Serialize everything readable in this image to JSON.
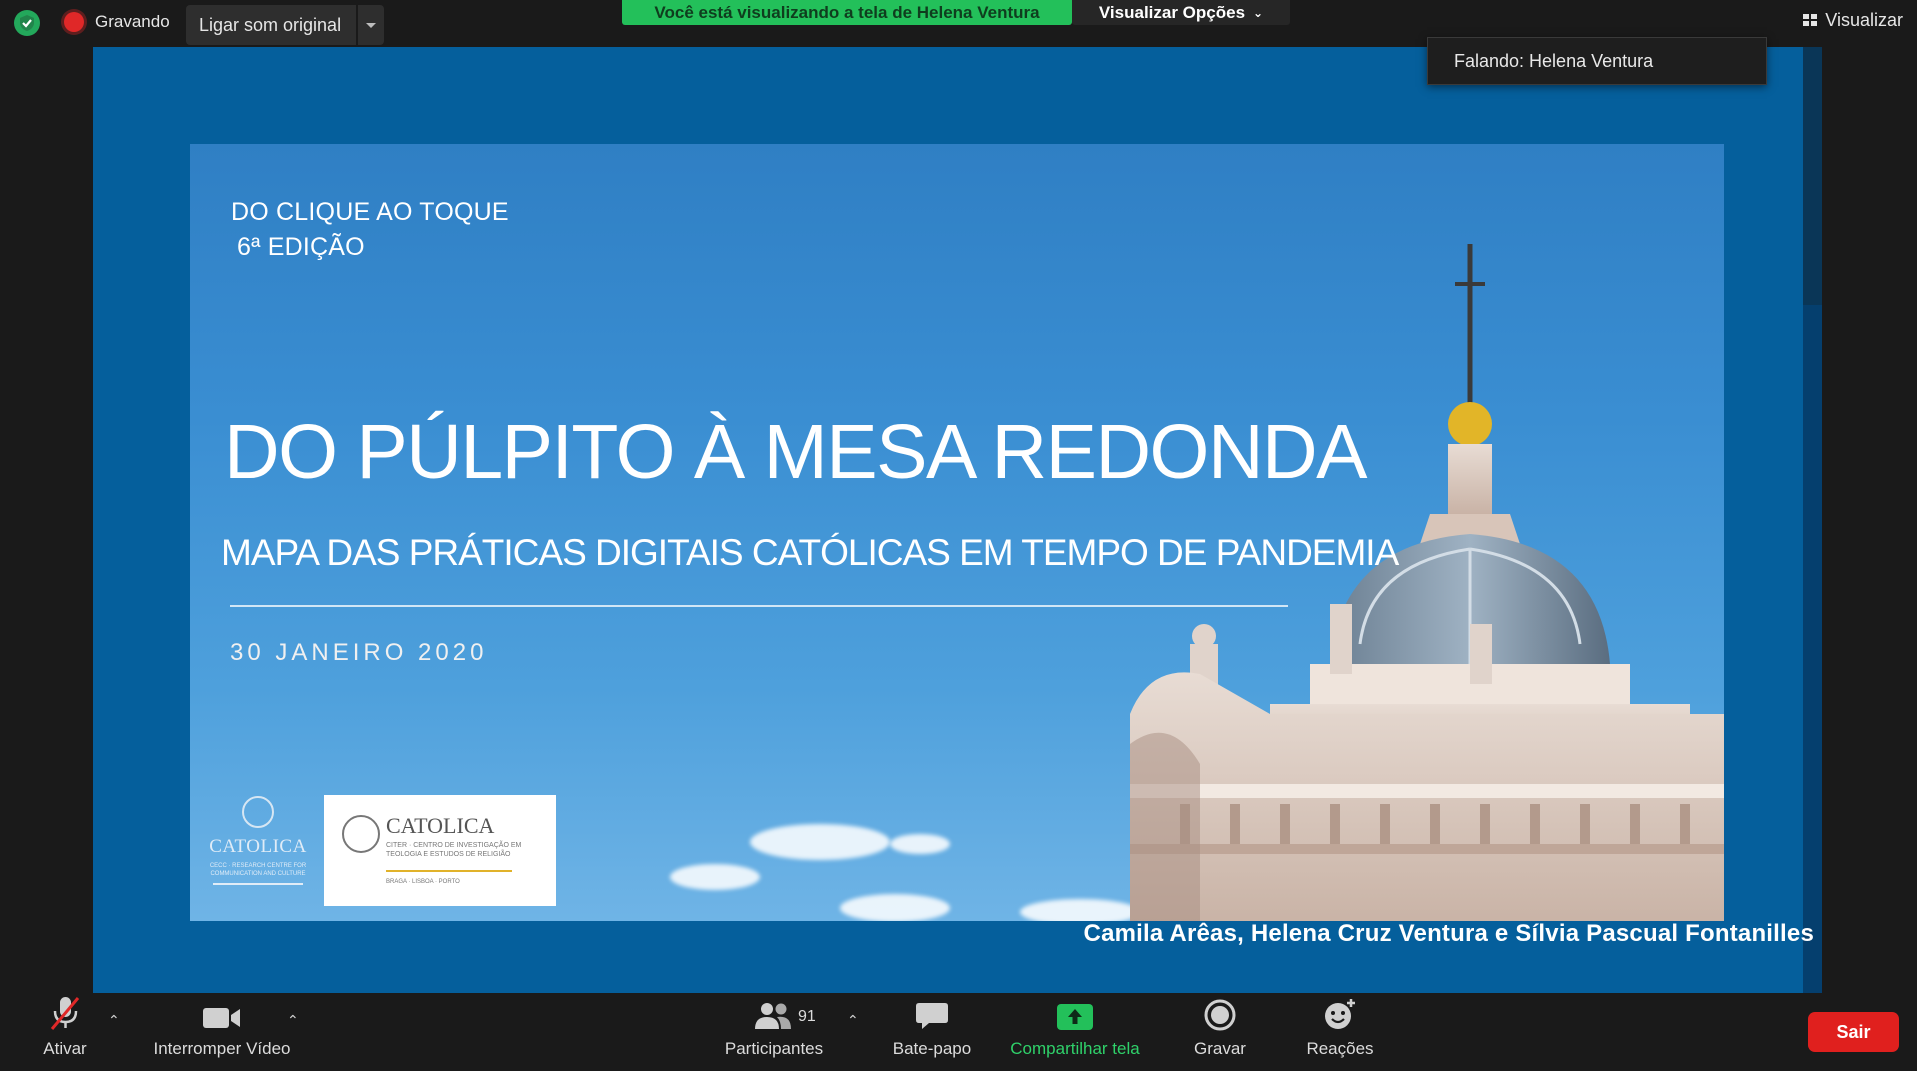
{
  "topbar": {
    "recording_label": "Gravando",
    "original_sound_label": "Ligar som original",
    "share_banner": "Você está visualizando a tela de Helena Ventura",
    "view_options_label": "Visualizar Opções",
    "view_label": "Visualizar"
  },
  "speaker_indicator": "Falando: Helena Ventura",
  "slide": {
    "kicker_line1": "DO CLIQUE AO TOQUE",
    "kicker_line2": "6ª EDIÇÃO",
    "title": "DO PÚLPITO À MESA REDONDA",
    "subtitle": "MAPA DAS PRÁTICAS DIGITAIS CATÓLICAS EM TEMPO DE PANDEMIA",
    "date": "30 JANEIRO 2020",
    "logo1": {
      "name": "CATOLICA",
      "tagline": "CECC · RESEARCH CENTRE FOR COMMUNICATION AND CULTURE"
    },
    "logo2": {
      "name": "CATOLICA",
      "tagline": "CITER · CENTRO DE INVESTIGAÇÃO EM TEOLOGIA E ESTUDOS DE RELIGIÃO",
      "cities": "BRAGA · LISBOA · PORTO"
    },
    "credits": "Camila Arêas, Helena Cruz Ventura e Sílvia Pascual Fontanilles"
  },
  "toolbar": {
    "mute_label": "Ativar",
    "video_label": "Interromper Vídeo",
    "participants_label": "Participantes",
    "participants_count": "91",
    "chat_label": "Bate-papo",
    "share_label": "Compartilhar tela",
    "record_label": "Gravar",
    "reactions_label": "Reações",
    "exit_label": "Sair"
  },
  "colors": {
    "accent_green": "#23c05a",
    "exit_red": "#e0201e",
    "screen_blue": "#055f9c"
  }
}
